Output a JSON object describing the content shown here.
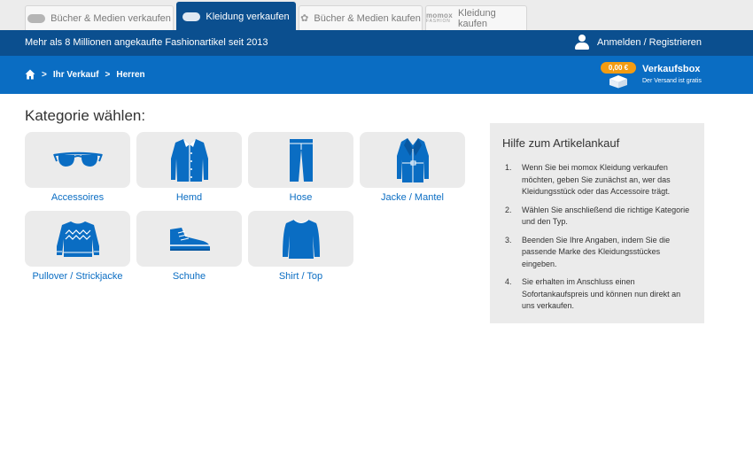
{
  "tabs": [
    {
      "label": "Bücher & Medien verkaufen",
      "icon": "momox-logo-icon",
      "active": false
    },
    {
      "label": "Kleidung verkaufen",
      "icon": "momox-logo-icon",
      "active": true
    },
    {
      "label": "Bücher & Medien kaufen",
      "icon": "medimops-logo-icon",
      "active": false
    },
    {
      "label": "Kleidung kaufen",
      "icon": "momox-fashion-logo-icon",
      "active": false,
      "brand": "momox",
      "brand_sub": "FASHION"
    }
  ],
  "infobar": {
    "tagline": "Mehr als 8 Millionen angekaufte Fashionartikel seit 2013",
    "account_label": "Anmelden / Registrieren"
  },
  "breadcrumb": {
    "items": [
      "Ihr Verkauf",
      "Herren"
    ],
    "separator": ">"
  },
  "sellbox": {
    "price": "0,00 €",
    "title": "Verkaufsbox",
    "subtitle": "Der Versand ist gratis"
  },
  "main": {
    "heading": "Kategorie wählen:",
    "categories": [
      {
        "label": "Accessoires",
        "icon": "sunglasses-icon"
      },
      {
        "label": "Hemd",
        "icon": "shirt-icon"
      },
      {
        "label": "Hose",
        "icon": "trousers-icon"
      },
      {
        "label": "Jacke / Mantel",
        "icon": "coat-icon"
      },
      {
        "label": "Pullover / Strickjacke",
        "icon": "sweater-icon"
      },
      {
        "label": "Schuhe",
        "icon": "sneaker-icon"
      },
      {
        "label": "Shirt / Top",
        "icon": "longsleeve-icon"
      }
    ]
  },
  "help": {
    "title": "Hilfe zum Artikelankauf",
    "steps": [
      "Wenn Sie bei momox Kleidung verkaufen möchten, geben Sie zunächst an, wer das Kleidungsstück oder das Accessoire trägt.",
      "Wählen Sie anschließend die richtige Kategorie und den Typ.",
      "Beenden Sie Ihre Angaben, indem Sie die passende Marke des Kleidungsstückes eingeben.",
      "Sie erhalten im Anschluss einen Sofortankaufspreis und können nun direkt an uns verkaufen."
    ]
  },
  "colors": {
    "dark_blue": "#0b4f8f",
    "blue": "#0a6dc3",
    "orange": "#f39c12",
    "tile_grey": "#ebebeb"
  }
}
